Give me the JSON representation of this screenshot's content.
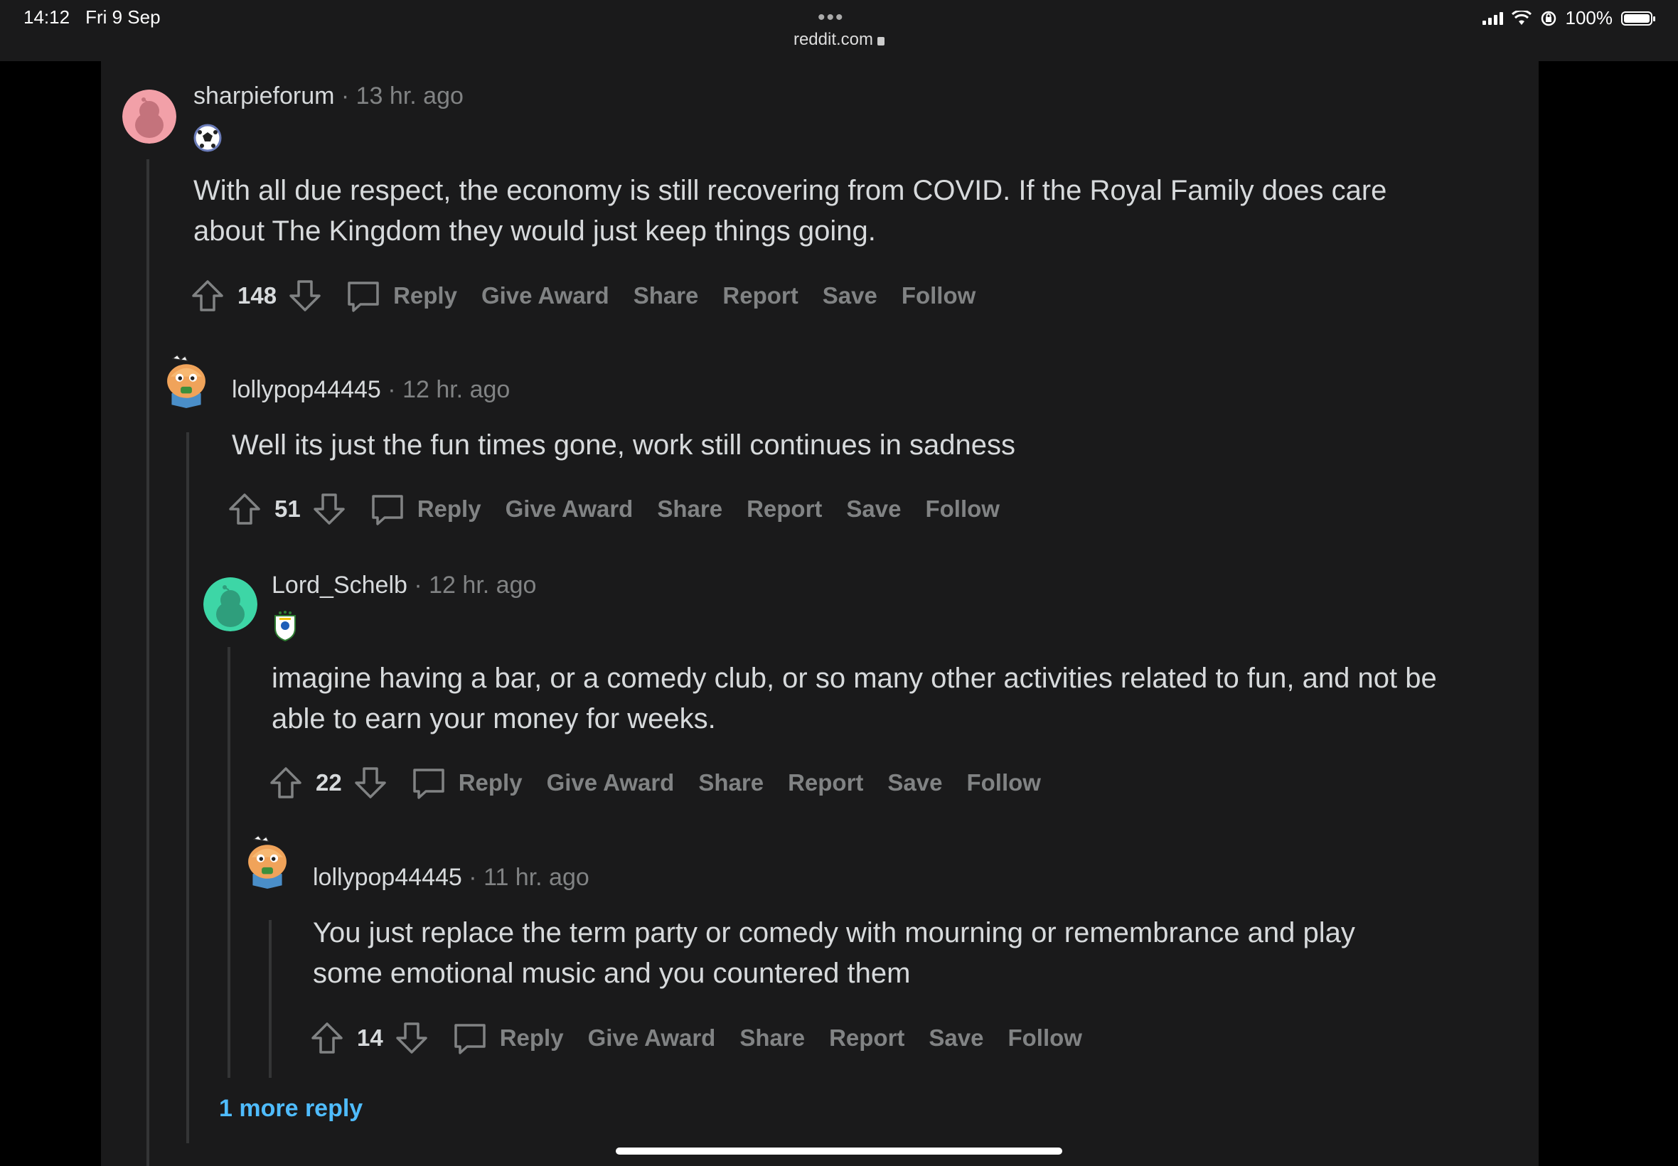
{
  "status_bar": {
    "time": "14:12",
    "date": "Fri 9 Sep",
    "url": "reddit.com",
    "battery": "100%"
  },
  "comments": [
    {
      "user": "sharpieforum",
      "time": "· 13 hr. ago",
      "body": "With all due respect, the economy is still recovering from COVID. If the Royal Family does care about The Kingdom they would just keep things going.",
      "score": "148",
      "avatar": "pink-snoo",
      "flair": "football-icon"
    },
    {
      "user": "lollypop44445",
      "time": "· 12 hr. ago",
      "body": "Well its just the fun times gone, work still continues in sadness",
      "score": "51",
      "avatar": "orange-character"
    },
    {
      "user": "Lord_Schelb",
      "time": "· 12 hr. ago",
      "body": "imagine having a bar, or a comedy club, or so many other activities related to fun, and not be able to earn your money for weeks.",
      "score": "22",
      "avatar": "teal-snoo",
      "flair": "crest-icon"
    },
    {
      "user": "lollypop44445",
      "time": "· 11 hr. ago",
      "body": "You just replace the term party or comedy with mourning or remembrance and play some emotional music and you countered them",
      "score": "14",
      "avatar": "orange-character"
    }
  ],
  "actions": {
    "reply": "Reply",
    "give_award": "Give Award",
    "share": "Share",
    "report": "Report",
    "save": "Save",
    "follow": "Follow"
  },
  "more_reply": "1 more reply",
  "colors": {
    "background": "#1a1a1b",
    "text": "#d7dadc",
    "muted": "#818384",
    "link": "#4fbcff"
  }
}
